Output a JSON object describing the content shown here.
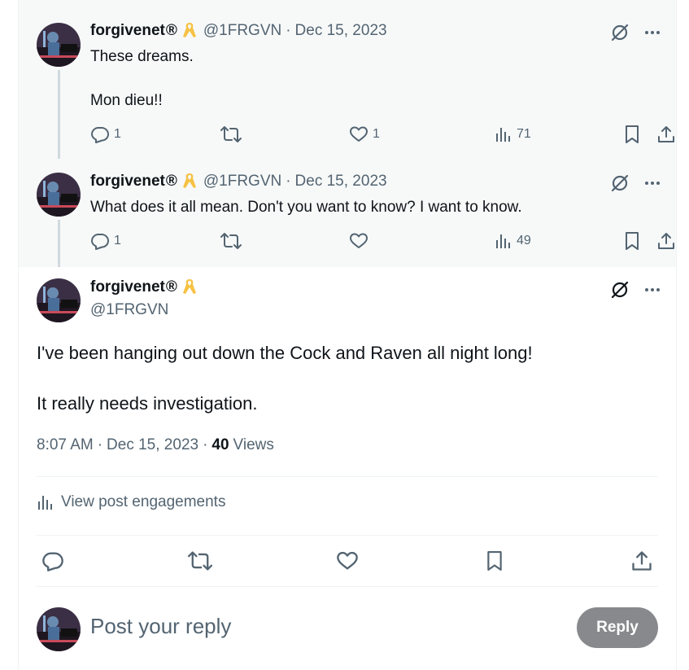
{
  "thread": [
    {
      "display_name": "forgivenet",
      "registered_mark": "®",
      "handle": "@1FRGVN",
      "separator": "·",
      "date": "Dec 15, 2023",
      "text": "These dreams.\n\nMon dieu!!",
      "replies": "1",
      "reposts": "",
      "likes": "1",
      "views": "71"
    },
    {
      "display_name": "forgivenet",
      "registered_mark": "®",
      "handle": "@1FRGVN",
      "separator": "·",
      "date": "Dec 15, 2023",
      "text": "What does it all mean. Don't you want to know? I want to know.",
      "replies": "1",
      "reposts": "",
      "likes": "",
      "views": "49"
    }
  ],
  "main_post": {
    "display_name": "forgivenet",
    "registered_mark": "®",
    "handle": "@1FRGVN",
    "text": "I've been hanging out down the Cock and Raven all night long!\n\nIt really needs investigation.",
    "time": "8:07 AM",
    "separator": "·",
    "date": "Dec 15, 2023",
    "separator2": "·",
    "views_count": "40",
    "views_label": "Views",
    "engagements_label": "View post engagements"
  },
  "reply_box": {
    "placeholder": "Post your reply",
    "button_label": "Reply"
  },
  "colors": {
    "accent_gray": "#536471",
    "reply_button": "#87898c",
    "ribbon": "#f6c244",
    "thread_bg": "#f7f9f9"
  },
  "icons": [
    "reply-icon",
    "repost-icon",
    "like-icon",
    "views-icon",
    "bookmark-icon",
    "share-icon",
    "grok-icon",
    "more-icon",
    "ribbon-icon"
  ]
}
